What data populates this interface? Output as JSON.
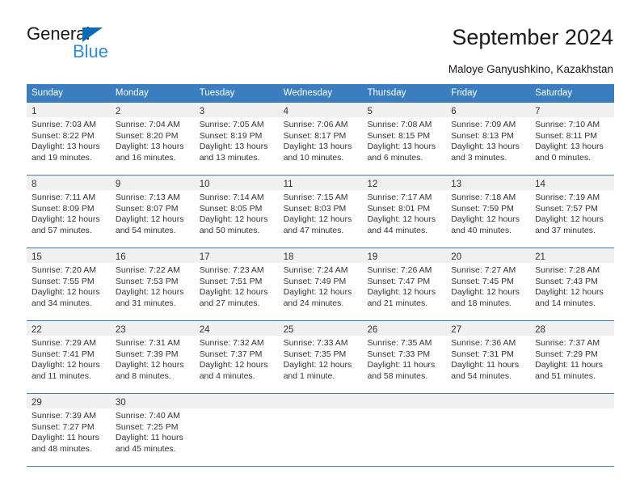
{
  "logo": {
    "word1": "General",
    "word2": "Blue",
    "triangle_color": "#0b6cb5",
    "blue_text_color": "#2e8bd4"
  },
  "header": {
    "title": "September 2024",
    "subtitle": "Maloye Ganyushkino, Kazakhstan"
  },
  "theme": {
    "header_bg": "#3a7ebf",
    "header_text": "#ffffff",
    "daynum_bg": "#f0f0f0",
    "cell_bg": "#ffffff",
    "text": "#333333"
  },
  "calendar": {
    "weekday_headers": [
      "Sunday",
      "Monday",
      "Tuesday",
      "Wednesday",
      "Thursday",
      "Friday",
      "Saturday"
    ],
    "weeks": [
      [
        {
          "day": "1",
          "sunrise": "Sunrise: 7:03 AM",
          "sunset": "Sunset: 8:22 PM",
          "daylight1": "Daylight: 13 hours",
          "daylight2": "and 19 minutes."
        },
        {
          "day": "2",
          "sunrise": "Sunrise: 7:04 AM",
          "sunset": "Sunset: 8:20 PM",
          "daylight1": "Daylight: 13 hours",
          "daylight2": "and 16 minutes."
        },
        {
          "day": "3",
          "sunrise": "Sunrise: 7:05 AM",
          "sunset": "Sunset: 8:19 PM",
          "daylight1": "Daylight: 13 hours",
          "daylight2": "and 13 minutes."
        },
        {
          "day": "4",
          "sunrise": "Sunrise: 7:06 AM",
          "sunset": "Sunset: 8:17 PM",
          "daylight1": "Daylight: 13 hours",
          "daylight2": "and 10 minutes."
        },
        {
          "day": "5",
          "sunrise": "Sunrise: 7:08 AM",
          "sunset": "Sunset: 8:15 PM",
          "daylight1": "Daylight: 13 hours",
          "daylight2": "and 6 minutes."
        },
        {
          "day": "6",
          "sunrise": "Sunrise: 7:09 AM",
          "sunset": "Sunset: 8:13 PM",
          "daylight1": "Daylight: 13 hours",
          "daylight2": "and 3 minutes."
        },
        {
          "day": "7",
          "sunrise": "Sunrise: 7:10 AM",
          "sunset": "Sunset: 8:11 PM",
          "daylight1": "Daylight: 13 hours",
          "daylight2": "and 0 minutes."
        }
      ],
      [
        {
          "day": "8",
          "sunrise": "Sunrise: 7:11 AM",
          "sunset": "Sunset: 8:09 PM",
          "daylight1": "Daylight: 12 hours",
          "daylight2": "and 57 minutes."
        },
        {
          "day": "9",
          "sunrise": "Sunrise: 7:13 AM",
          "sunset": "Sunset: 8:07 PM",
          "daylight1": "Daylight: 12 hours",
          "daylight2": "and 54 minutes."
        },
        {
          "day": "10",
          "sunrise": "Sunrise: 7:14 AM",
          "sunset": "Sunset: 8:05 PM",
          "daylight1": "Daylight: 12 hours",
          "daylight2": "and 50 minutes."
        },
        {
          "day": "11",
          "sunrise": "Sunrise: 7:15 AM",
          "sunset": "Sunset: 8:03 PM",
          "daylight1": "Daylight: 12 hours",
          "daylight2": "and 47 minutes."
        },
        {
          "day": "12",
          "sunrise": "Sunrise: 7:17 AM",
          "sunset": "Sunset: 8:01 PM",
          "daylight1": "Daylight: 12 hours",
          "daylight2": "and 44 minutes."
        },
        {
          "day": "13",
          "sunrise": "Sunrise: 7:18 AM",
          "sunset": "Sunset: 7:59 PM",
          "daylight1": "Daylight: 12 hours",
          "daylight2": "and 40 minutes."
        },
        {
          "day": "14",
          "sunrise": "Sunrise: 7:19 AM",
          "sunset": "Sunset: 7:57 PM",
          "daylight1": "Daylight: 12 hours",
          "daylight2": "and 37 minutes."
        }
      ],
      [
        {
          "day": "15",
          "sunrise": "Sunrise: 7:20 AM",
          "sunset": "Sunset: 7:55 PM",
          "daylight1": "Daylight: 12 hours",
          "daylight2": "and 34 minutes."
        },
        {
          "day": "16",
          "sunrise": "Sunrise: 7:22 AM",
          "sunset": "Sunset: 7:53 PM",
          "daylight1": "Daylight: 12 hours",
          "daylight2": "and 31 minutes."
        },
        {
          "day": "17",
          "sunrise": "Sunrise: 7:23 AM",
          "sunset": "Sunset: 7:51 PM",
          "daylight1": "Daylight: 12 hours",
          "daylight2": "and 27 minutes."
        },
        {
          "day": "18",
          "sunrise": "Sunrise: 7:24 AM",
          "sunset": "Sunset: 7:49 PM",
          "daylight1": "Daylight: 12 hours",
          "daylight2": "and 24 minutes."
        },
        {
          "day": "19",
          "sunrise": "Sunrise: 7:26 AM",
          "sunset": "Sunset: 7:47 PM",
          "daylight1": "Daylight: 12 hours",
          "daylight2": "and 21 minutes."
        },
        {
          "day": "20",
          "sunrise": "Sunrise: 7:27 AM",
          "sunset": "Sunset: 7:45 PM",
          "daylight1": "Daylight: 12 hours",
          "daylight2": "and 18 minutes."
        },
        {
          "day": "21",
          "sunrise": "Sunrise: 7:28 AM",
          "sunset": "Sunset: 7:43 PM",
          "daylight1": "Daylight: 12 hours",
          "daylight2": "and 14 minutes."
        }
      ],
      [
        {
          "day": "22",
          "sunrise": "Sunrise: 7:29 AM",
          "sunset": "Sunset: 7:41 PM",
          "daylight1": "Daylight: 12 hours",
          "daylight2": "and 11 minutes."
        },
        {
          "day": "23",
          "sunrise": "Sunrise: 7:31 AM",
          "sunset": "Sunset: 7:39 PM",
          "daylight1": "Daylight: 12 hours",
          "daylight2": "and 8 minutes."
        },
        {
          "day": "24",
          "sunrise": "Sunrise: 7:32 AM",
          "sunset": "Sunset: 7:37 PM",
          "daylight1": "Daylight: 12 hours",
          "daylight2": "and 4 minutes."
        },
        {
          "day": "25",
          "sunrise": "Sunrise: 7:33 AM",
          "sunset": "Sunset: 7:35 PM",
          "daylight1": "Daylight: 12 hours",
          "daylight2": "and 1 minute."
        },
        {
          "day": "26",
          "sunrise": "Sunrise: 7:35 AM",
          "sunset": "Sunset: 7:33 PM",
          "daylight1": "Daylight: 11 hours",
          "daylight2": "and 58 minutes."
        },
        {
          "day": "27",
          "sunrise": "Sunrise: 7:36 AM",
          "sunset": "Sunset: 7:31 PM",
          "daylight1": "Daylight: 11 hours",
          "daylight2": "and 54 minutes."
        },
        {
          "day": "28",
          "sunrise": "Sunrise: 7:37 AM",
          "sunset": "Sunset: 7:29 PM",
          "daylight1": "Daylight: 11 hours",
          "daylight2": "and 51 minutes."
        }
      ],
      [
        {
          "day": "29",
          "sunrise": "Sunrise: 7:39 AM",
          "sunset": "Sunset: 7:27 PM",
          "daylight1": "Daylight: 11 hours",
          "daylight2": "and 48 minutes."
        },
        {
          "day": "30",
          "sunrise": "Sunrise: 7:40 AM",
          "sunset": "Sunset: 7:25 PM",
          "daylight1": "Daylight: 11 hours",
          "daylight2": "and 45 minutes."
        },
        {
          "day": "",
          "sunrise": "",
          "sunset": "",
          "daylight1": "",
          "daylight2": ""
        },
        {
          "day": "",
          "sunrise": "",
          "sunset": "",
          "daylight1": "",
          "daylight2": ""
        },
        {
          "day": "",
          "sunrise": "",
          "sunset": "",
          "daylight1": "",
          "daylight2": ""
        },
        {
          "day": "",
          "sunrise": "",
          "sunset": "",
          "daylight1": "",
          "daylight2": ""
        },
        {
          "day": "",
          "sunrise": "",
          "sunset": "",
          "daylight1": "",
          "daylight2": ""
        }
      ]
    ]
  }
}
